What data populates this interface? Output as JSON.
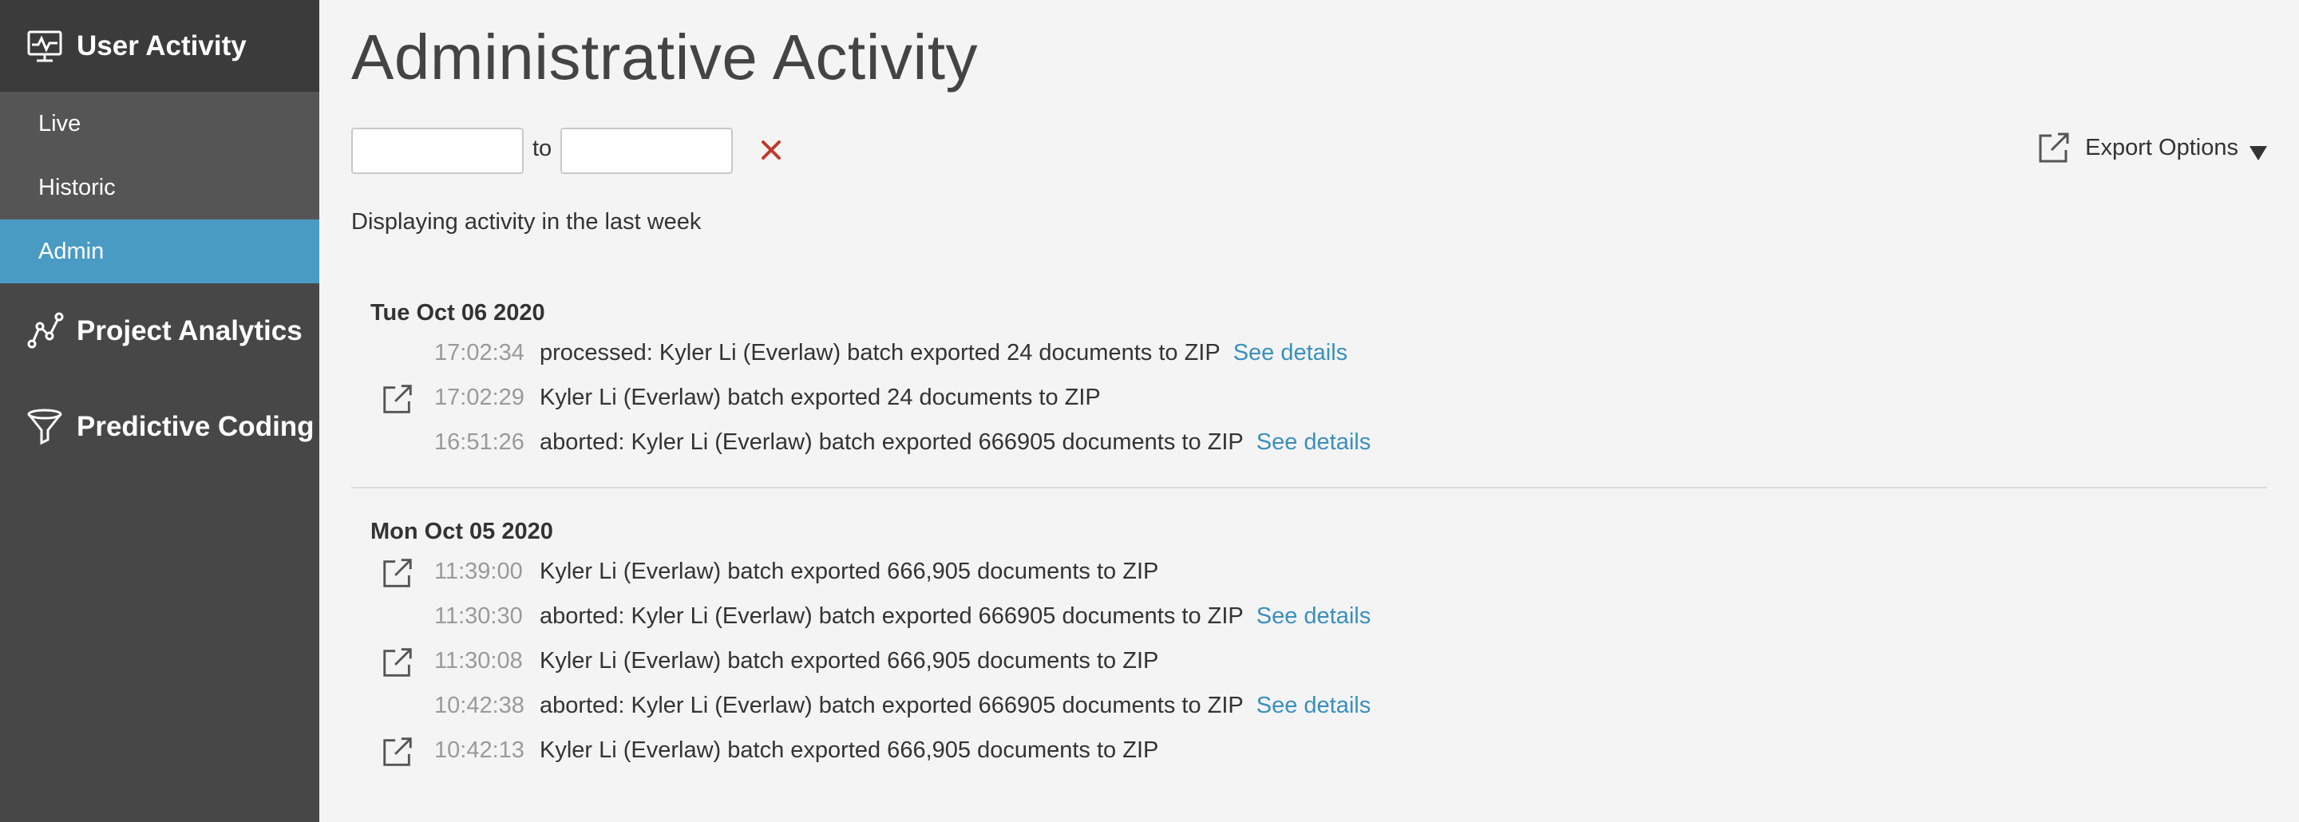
{
  "sidebar": {
    "user_activity": {
      "label": "User Activity",
      "icon": "activity-monitor-icon"
    },
    "items": [
      {
        "label": "Live",
        "selected": false
      },
      {
        "label": "Historic",
        "selected": false
      },
      {
        "label": "Admin",
        "selected": true
      }
    ],
    "project_analytics": {
      "label": "Project Analytics",
      "icon": "analytics-graph-icon"
    },
    "predictive_coding": {
      "label": "Predictive Coding",
      "icon": "funnel-icon"
    },
    "selected_color": "#4a9bc4"
  },
  "main": {
    "title": "Administrative Activity",
    "date_from": {
      "value": "",
      "placeholder": ""
    },
    "date_to_label": "to",
    "date_to": {
      "value": "",
      "placeholder": ""
    },
    "export_label": "Export Options",
    "summary": "Displaying activity in the last week",
    "link_color": "#3a8fbd",
    "days": [
      {
        "date": "Tue Oct 06 2020",
        "entries": [
          {
            "time": "17:02:34",
            "message": "processed: Kyler Li (Everlaw) batch exported 24 documents to ZIP",
            "link": "See details",
            "icon": false
          },
          {
            "time": "17:02:29",
            "message": "Kyler Li (Everlaw) batch exported 24 documents to ZIP",
            "link": "",
            "icon": true
          },
          {
            "time": "16:51:26",
            "message": "aborted: Kyler Li (Everlaw) batch exported 666905 documents to ZIP",
            "link": "See details",
            "icon": false
          }
        ]
      },
      {
        "date": "Mon Oct 05 2020",
        "entries": [
          {
            "time": "11:39:00",
            "message": "Kyler Li (Everlaw) batch exported 666,905 documents to ZIP",
            "link": "",
            "icon": true
          },
          {
            "time": "11:30:30",
            "message": "aborted: Kyler Li (Everlaw) batch exported 666905 documents to ZIP",
            "link": "See details",
            "icon": false
          },
          {
            "time": "11:30:08",
            "message": "Kyler Li (Everlaw) batch exported 666,905 documents to ZIP",
            "link": "",
            "icon": true
          },
          {
            "time": "10:42:38",
            "message": "aborted: Kyler Li (Everlaw) batch exported 666905 documents to ZIP",
            "link": "See details",
            "icon": false
          },
          {
            "time": "10:42:13",
            "message": "Kyler Li (Everlaw) batch exported 666,905 documents to ZIP",
            "link": "",
            "icon": true
          }
        ]
      }
    ]
  }
}
